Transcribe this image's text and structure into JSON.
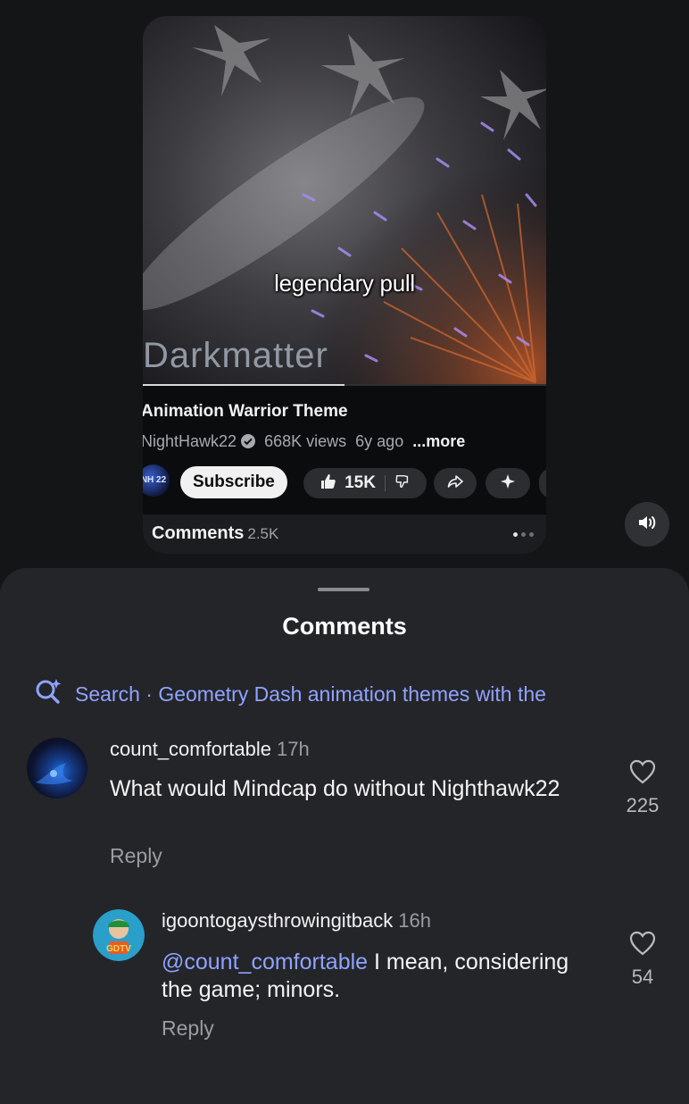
{
  "video": {
    "overlay_caption": "legendary pull",
    "watermark": "Darkmatter",
    "progress": 0.5,
    "title": "Animation Warrior Theme",
    "channel": "NightHawk22",
    "channel_avatar_text": "NH 22",
    "views": "668K views",
    "age": "6y ago",
    "more_label": "...more",
    "subscribe_label": "Subscribe",
    "likes": "15K",
    "comments_label": "Comments",
    "comments_count": "2.5K"
  },
  "sheet": {
    "title": "Comments",
    "search_text": "Search · Geometry Dash animation themes with the"
  },
  "comments": [
    {
      "username": "count_comfortable",
      "time": "17h",
      "text": "What would Mindcap do without Nighthawk22",
      "reply_label": "Reply",
      "likes": "225"
    },
    {
      "username": "igoontogaysthrowingitback",
      "time": "16h",
      "mention": "@count_comfortable",
      "text": " I mean, considering the game; minors.",
      "reply_label": "Reply",
      "likes": "54",
      "avatar_badge": "GDTV"
    }
  ],
  "icons": {
    "verified": "verified-check-icon",
    "like": "thumbs-up-icon",
    "dislike": "thumbs-down-icon",
    "share": "share-arrow-icon",
    "remix": "sparkle-icon",
    "volume": "speaker-icon",
    "search": "search-sparkle-icon",
    "heart": "heart-icon"
  },
  "colors": {
    "accent_blue": "#8fa3ff",
    "sheet_bg": "#242529",
    "page_bg": "#141517"
  }
}
